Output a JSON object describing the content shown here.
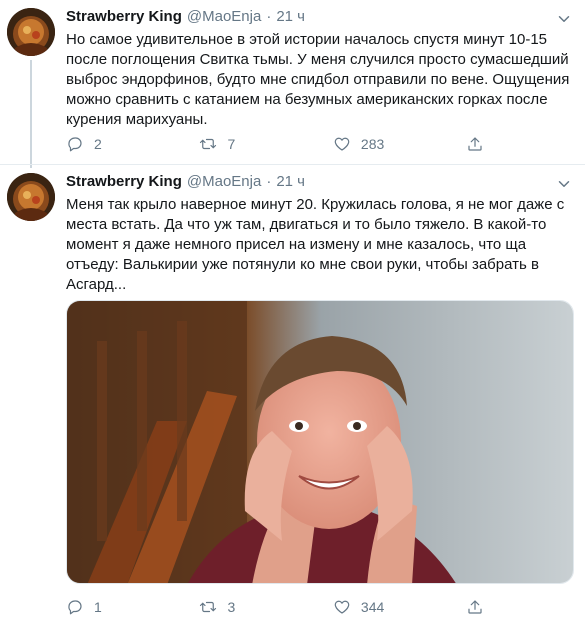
{
  "tweets": [
    {
      "author_name": "Strawberry King",
      "author_handle": "@MaoEnja",
      "separator": "·",
      "time": "21 ч",
      "text": "Но самое удивительное в этой истории началось спустя минут 10-15\nпосле поглощения Свитка тьмы. У меня случился просто сумасшедший\nвыброс эндорфинов, будто мне спидбол отправили по вене. Ощущения\nможно сравнить с катанием на безумных американских горках после\nкурения марихуаны.",
      "replies": "2",
      "retweets": "7",
      "likes": "283"
    },
    {
      "author_name": "Strawberry King",
      "author_handle": "@MaoEnja",
      "separator": "·",
      "time": "21 ч",
      "text": "Меня так крыло наверное минут 20. Кружилась голова, я не мог даже с\nместа встать. Да что уж там, двигаться и то было тяжело. В какой-то\nмомент я даже немного присел на измену и мне казалось, что ща\nотъеду: Валькирии уже потянули ко мне свои руки, чтобы забрать в\nАсгард...",
      "replies": "1",
      "retweets": "3",
      "likes": "344"
    }
  ],
  "icons": {
    "reply": "reply-icon",
    "retweet": "retweet-icon",
    "like": "heart-icon",
    "share": "share-icon",
    "more": "chevron-down-icon"
  },
  "colors": {
    "text": "#14171a",
    "muted": "#657786",
    "border": "#e6ecf0"
  }
}
